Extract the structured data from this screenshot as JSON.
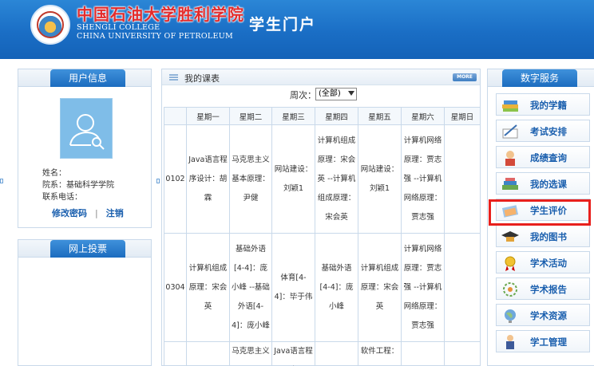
{
  "header": {
    "school_cn": "中国石油大学胜利学院",
    "school_en_line1": "SHENGLI COLLEGE",
    "school_en_line2": "CHINA UNIVERSITY OF PETROLEUM",
    "portal_title": "学生门户"
  },
  "user_info": {
    "title": "用户信息",
    "name_label": "姓名：",
    "name_value": "",
    "dept_label": "院系：",
    "dept_value": "基础科学学院",
    "phone_label": "联系电话：",
    "phone_value": "",
    "change_password": "修改密码",
    "separator": "|",
    "logout": "注销"
  },
  "vote": {
    "title": "网上投票"
  },
  "schedule": {
    "title": "我的课表",
    "more": "MORE",
    "week_label": "周次：",
    "week_selected": "(全部)",
    "columns": [
      "",
      "星期一",
      "星期二",
      "星期三",
      "星期四",
      "星期五",
      "星期六",
      "星期日"
    ],
    "rows": [
      {
        "period": "0102",
        "cells": [
          "Java语言程序设计：胡霖",
          "马克思主义基本原理：尹健",
          "网站建设：刘颖1",
          "计算机组成原理：宋会英 --计算机组成原理：宋会英",
          "网站建设：刘颖1",
          "计算机网络原理：贾志强 --计算机网络原理：贾志强",
          ""
        ]
      },
      {
        "period": "0304",
        "cells": [
          "计算机组成原理：宋会英",
          "基础外语[4-4]：庞小峰 --基础外语[4-4]：庞小峰",
          "体育[4-4]：毕于伟",
          "基础外语[4-4]：庞小峰",
          "计算机组成原理：宋会英",
          "计算机网络原理：贾志强 --计算机网络原理：贾志强",
          ""
        ]
      },
      {
        "period": "",
        "cells": [
          "",
          "马克思主义",
          "Java语言程序",
          "",
          "软件工程：",
          "",
          ""
        ]
      }
    ]
  },
  "services": {
    "title": "数字服务",
    "items": [
      {
        "label": "我的学籍",
        "icon": "books-icon"
      },
      {
        "label": "考试安排",
        "icon": "pen-paper-icon"
      },
      {
        "label": "成绩查询",
        "icon": "student-icon"
      },
      {
        "label": "我的选课",
        "icon": "book-stack-icon"
      },
      {
        "label": "学生评价",
        "icon": "evaluation-icon"
      },
      {
        "label": "我的图书",
        "icon": "graduation-cap-icon"
      },
      {
        "label": "学术活动",
        "icon": "medal-icon"
      },
      {
        "label": "学术报告",
        "icon": "gear-flower-icon"
      },
      {
        "label": "学术资源",
        "icon": "globe-icon"
      },
      {
        "label": "学工管理",
        "icon": "teacher-icon"
      }
    ],
    "highlighted": "学生评价",
    "highlight_color": "#e8201d"
  },
  "colors": {
    "header_blue": "#1a6ec5",
    "tab_blue": "#2a7ccc",
    "link_blue": "#1a5fae",
    "border": "#c9d9ea"
  }
}
